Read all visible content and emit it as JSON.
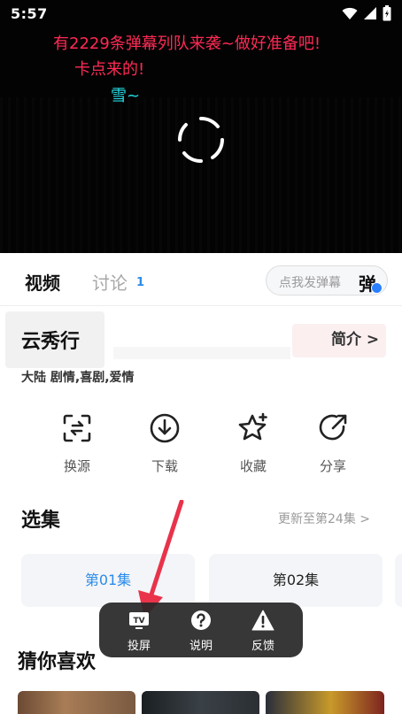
{
  "status_bar": {
    "time": "5:57"
  },
  "player": {
    "danmaku": [
      {
        "text": "有2229条弹幕列队来袭~做好准备吧!",
        "color": "#ff2a55"
      },
      {
        "text": "卡点来的!",
        "color": "#ff2a55"
      },
      {
        "text": "雪~",
        "color": "#24d6e0"
      }
    ]
  },
  "tabs": {
    "video_label": "视频",
    "comment_label": "讨论",
    "comment_count": "1",
    "danmaku_placeholder": "点我发弹幕",
    "danmaku_button": "弹"
  },
  "show": {
    "title": "云秀行",
    "intro_link": "简介 >",
    "tags": "大陆  剧情,喜剧,爱情"
  },
  "actions": [
    {
      "label": "换源",
      "icon": "switch-source-icon"
    },
    {
      "label": "下载",
      "icon": "download-icon"
    },
    {
      "label": "收藏",
      "icon": "star-icon"
    },
    {
      "label": "分享",
      "icon": "share-icon"
    }
  ],
  "episodes": {
    "title": "选集",
    "update_text": "更新至第24集 >",
    "items": [
      "第01集",
      "第02集"
    ]
  },
  "recommend": {
    "title": "猜你喜欢"
  },
  "popup": {
    "items": [
      {
        "label": "投屏",
        "icon": "tv-cast-icon"
      },
      {
        "label": "说明",
        "icon": "help-icon"
      },
      {
        "label": "反馈",
        "icon": "warning-icon"
      }
    ]
  },
  "colors": {
    "accent": "#2a8be8",
    "danmaku_red": "#ff2a55",
    "danmaku_cyan": "#24d6e0",
    "annotation_arrow": "#e8334a"
  }
}
